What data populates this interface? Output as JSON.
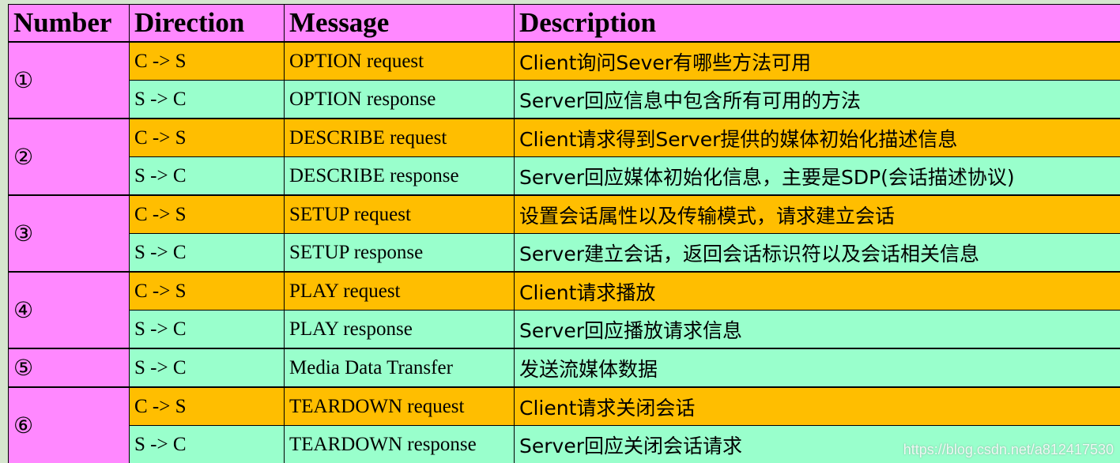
{
  "table": {
    "headers": {
      "number": "Number",
      "direction": "Direction",
      "message": "Message",
      "description": "Description"
    },
    "groups": [
      {
        "number": "①",
        "rows": [
          {
            "direction": "C -> S",
            "message": "OPTION request",
            "description": "Client询问Sever有哪些方法可用",
            "kind": "request"
          },
          {
            "direction": "S -> C",
            "message": "OPTION response",
            "description": "Server回应信息中包含所有可用的方法",
            "kind": "response"
          }
        ]
      },
      {
        "number": "②",
        "rows": [
          {
            "direction": "C -> S",
            "message": "DESCRIBE request",
            "description": "Client请求得到Server提供的媒体初始化描述信息",
            "kind": "request"
          },
          {
            "direction": "S -> C",
            "message": "DESCRIBE response",
            "description": "Server回应媒体初始化信息，主要是SDP(会话描述协议)",
            "kind": "response"
          }
        ]
      },
      {
        "number": "③",
        "rows": [
          {
            "direction": "C -> S",
            "message": "SETUP request",
            "description": "设置会话属性以及传输模式，请求建立会话",
            "kind": "request"
          },
          {
            "direction": "S -> C",
            "message": "SETUP response",
            "description": "Server建立会话，返回会话标识符以及会话相关信息",
            "kind": "response"
          }
        ]
      },
      {
        "number": "④",
        "rows": [
          {
            "direction": "C -> S",
            "message": "PLAY request",
            "description": "Client请求播放",
            "kind": "request"
          },
          {
            "direction": "S -> C",
            "message": "PLAY response",
            "description": "Server回应播放请求信息",
            "kind": "response"
          }
        ]
      },
      {
        "number": "⑤",
        "rows": [
          {
            "direction": "S -> C",
            "message": "Media Data Transfer",
            "description": "发送流媒体数据",
            "kind": "response"
          }
        ]
      },
      {
        "number": "⑥",
        "rows": [
          {
            "direction": "C -> S",
            "message": "TEARDOWN request",
            "description": "Client请求关闭会话",
            "kind": "request"
          },
          {
            "direction": "S -> C",
            "message": "TEARDOWN response",
            "description": "Server回应关闭会话请求",
            "kind": "response"
          }
        ]
      }
    ]
  },
  "watermark": "https://blog.csdn.net/a812417530",
  "colors": {
    "header_bg": "#ff88ff",
    "number_bg": "#ff88ff",
    "request_bg": "#ffbe00",
    "response_bg": "#99ffcc",
    "page_bg": "#d6e6cf"
  }
}
